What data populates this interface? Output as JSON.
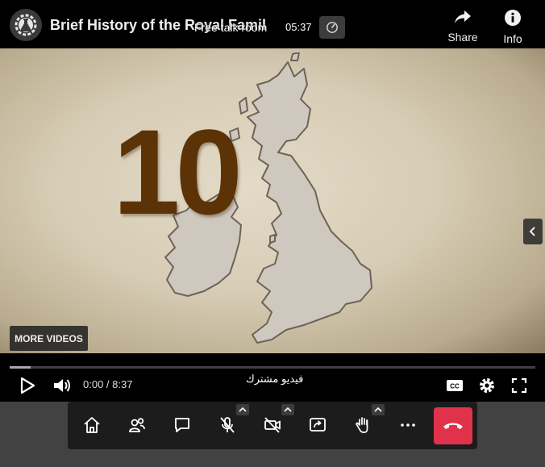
{
  "header": {
    "video_title": "Brief History of the Royal Family",
    "room_name": "Free talk room",
    "timer": "05:37",
    "share_label": "Share",
    "info_label": "Info"
  },
  "video": {
    "overlay_number": "10",
    "more_videos_label": "MORE VIDEOS"
  },
  "player": {
    "time_display": "0:00 / 8:37",
    "subtitle": "فيديو مشترك",
    "progress_fraction": 0.04
  },
  "toolbar": {
    "buttons": [
      "home-icon",
      "participants-icon",
      "chat-icon",
      "microphone-muted-icon",
      "camera-off-icon",
      "screen-share-icon",
      "raise-hand-icon",
      "more-icon",
      "hang-up-icon"
    ]
  },
  "colors": {
    "number_color": "#5b3306",
    "hangup_color": "#e0324a",
    "toolbar_bg": "#1c1c1c",
    "parchment": "#d7cdb6"
  }
}
